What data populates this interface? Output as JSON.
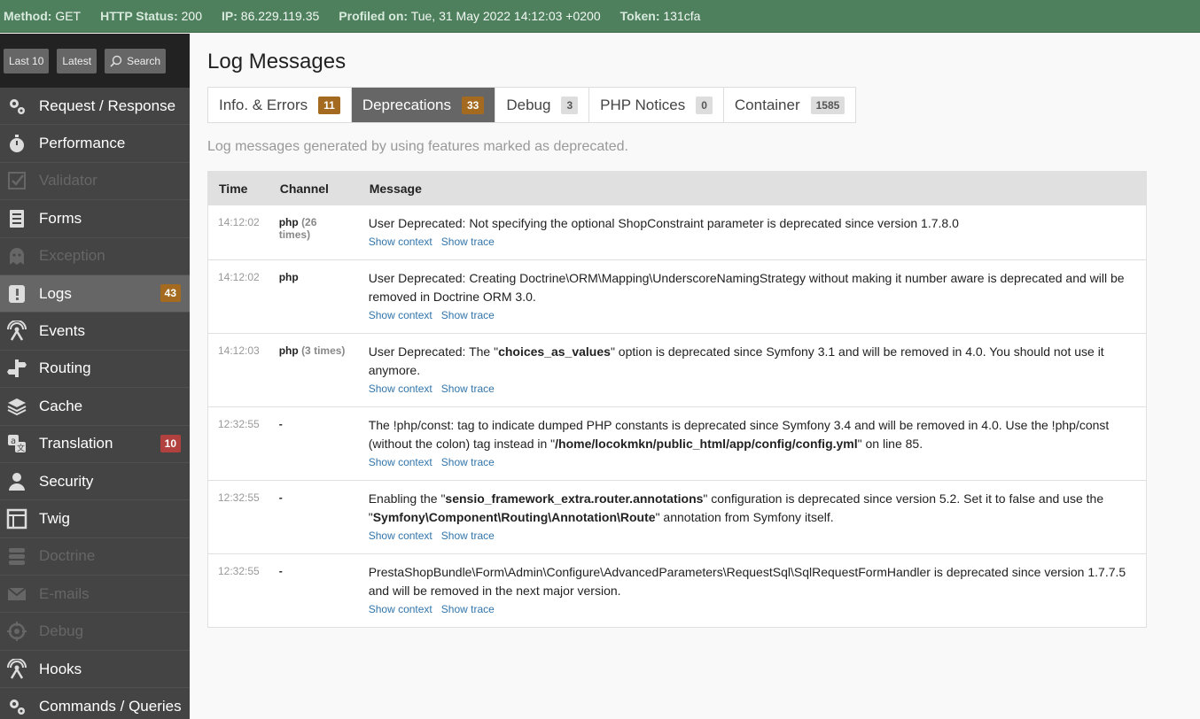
{
  "status_bar": {
    "method_label": "Method:",
    "method": "GET",
    "http_status_label": "HTTP Status:",
    "http_status": "200",
    "ip_label": "IP:",
    "ip": "86.229.119.35",
    "profiled_label": "Profiled on:",
    "profiled": "Tue, 31 May 2022 14:12:03 +0200",
    "token_label": "Token:",
    "token": "131cfa"
  },
  "sidebar": {
    "buttons": {
      "last10": "Last 10",
      "latest": "Latest",
      "search": "Search"
    },
    "items": [
      {
        "label": "Request / Response",
        "icon": "gears-icon",
        "state": "enabled"
      },
      {
        "label": "Performance",
        "icon": "stopwatch-icon",
        "state": "enabled"
      },
      {
        "label": "Validator",
        "icon": "checkbox-icon",
        "state": "disabled"
      },
      {
        "label": "Forms",
        "icon": "form-icon",
        "state": "enabled"
      },
      {
        "label": "Exception",
        "icon": "ghost-icon",
        "state": "disabled"
      },
      {
        "label": "Logs",
        "icon": "logs-icon",
        "state": "selected",
        "count": "43"
      },
      {
        "label": "Events",
        "icon": "antenna-icon",
        "state": "enabled"
      },
      {
        "label": "Routing",
        "icon": "signpost-icon",
        "state": "enabled"
      },
      {
        "label": "Cache",
        "icon": "layers-icon",
        "state": "enabled"
      },
      {
        "label": "Translation",
        "icon": "translate-icon",
        "state": "enabled",
        "count": "10"
      },
      {
        "label": "Security",
        "icon": "user-icon",
        "state": "enabled"
      },
      {
        "label": "Twig",
        "icon": "template-icon",
        "state": "enabled"
      },
      {
        "label": "Doctrine",
        "icon": "database-icon",
        "state": "disabled"
      },
      {
        "label": "E-mails",
        "icon": "envelope-icon",
        "state": "disabled"
      },
      {
        "label": "Debug",
        "icon": "crosshair-icon",
        "state": "disabled"
      },
      {
        "label": "Hooks",
        "icon": "antenna-icon",
        "state": "enabled"
      },
      {
        "label": "Commands / Queries",
        "icon": "gears-icon",
        "state": "enabled"
      }
    ]
  },
  "main": {
    "title": "Log Messages",
    "tabs": [
      {
        "label": "Info. & Errors",
        "count": "11",
        "active": false
      },
      {
        "label": "Deprecations",
        "count": "33",
        "active": true
      },
      {
        "label": "Debug",
        "count": "3",
        "active": false
      },
      {
        "label": "PHP Notices",
        "count": "0",
        "active": false
      },
      {
        "label": "Container",
        "count": "1585",
        "active": false
      }
    ],
    "help": "Log messages generated by using features marked as deprecated.",
    "table": {
      "headers": {
        "time": "Time",
        "channel": "Channel",
        "message": "Message"
      },
      "link_context": "Show context",
      "link_trace": "Show trace",
      "rows": [
        {
          "time": "14:12:02",
          "channel": "php",
          "times": "(26 times)",
          "message": [
            {
              "t": "User Deprecated: Not specifying the optional ShopConstraint parameter is deprecated since version 1.7.8.0"
            }
          ]
        },
        {
          "time": "14:12:02",
          "channel": "php",
          "times": "",
          "message": [
            {
              "t": "User Deprecated: Creating Doctrine\\ORM\\Mapping\\UnderscoreNamingStrategy without making it number aware is deprecated and will be removed in Doctrine ORM 3.0."
            }
          ]
        },
        {
          "time": "14:12:03",
          "channel": "php",
          "times": "(3 times)",
          "message": [
            {
              "t": "User Deprecated: The \""
            },
            {
              "t": "choices_as_values",
              "b": true
            },
            {
              "t": "\" option is deprecated since Symfony 3.1 and will be removed in 4.0. You should not use it anymore."
            }
          ]
        },
        {
          "time": "12:32:55",
          "channel": "-",
          "times": "",
          "message": [
            {
              "t": "The !php/const: tag to indicate dumped PHP constants is deprecated since Symfony 3.4 and will be removed in 4.0. Use the !php/const (without the colon) tag instead in \""
            },
            {
              "t": "/home/locokmkn/public_html/app/config/config.yml",
              "b": true
            },
            {
              "t": "\" on line 85."
            }
          ]
        },
        {
          "time": "12:32:55",
          "channel": "-",
          "times": "",
          "message": [
            {
              "t": "Enabling the \""
            },
            {
              "t": "sensio_framework_extra.router.annotations",
              "b": true
            },
            {
              "t": "\" configuration is deprecated since version 5.2. Set it to false and use the \""
            },
            {
              "t": "Symfony\\Component\\Routing\\Annotation\\Route",
              "b": true
            },
            {
              "t": "\" annotation from Symfony itself."
            }
          ]
        },
        {
          "time": "12:32:55",
          "channel": "-",
          "times": "",
          "message": [
            {
              "t": "PrestaShopBundle\\Form\\Admin\\Configure\\AdvancedParameters\\RequestSql\\SqlRequestFormHandler is deprecated since version 1.7.7.5 and will be removed in the next major version."
            }
          ]
        }
      ]
    }
  },
  "colors": {
    "status_bar": "#4f805d",
    "badge_warning": "#a46a1f",
    "badge_error": "#b0413e",
    "link": "#3275aa"
  }
}
